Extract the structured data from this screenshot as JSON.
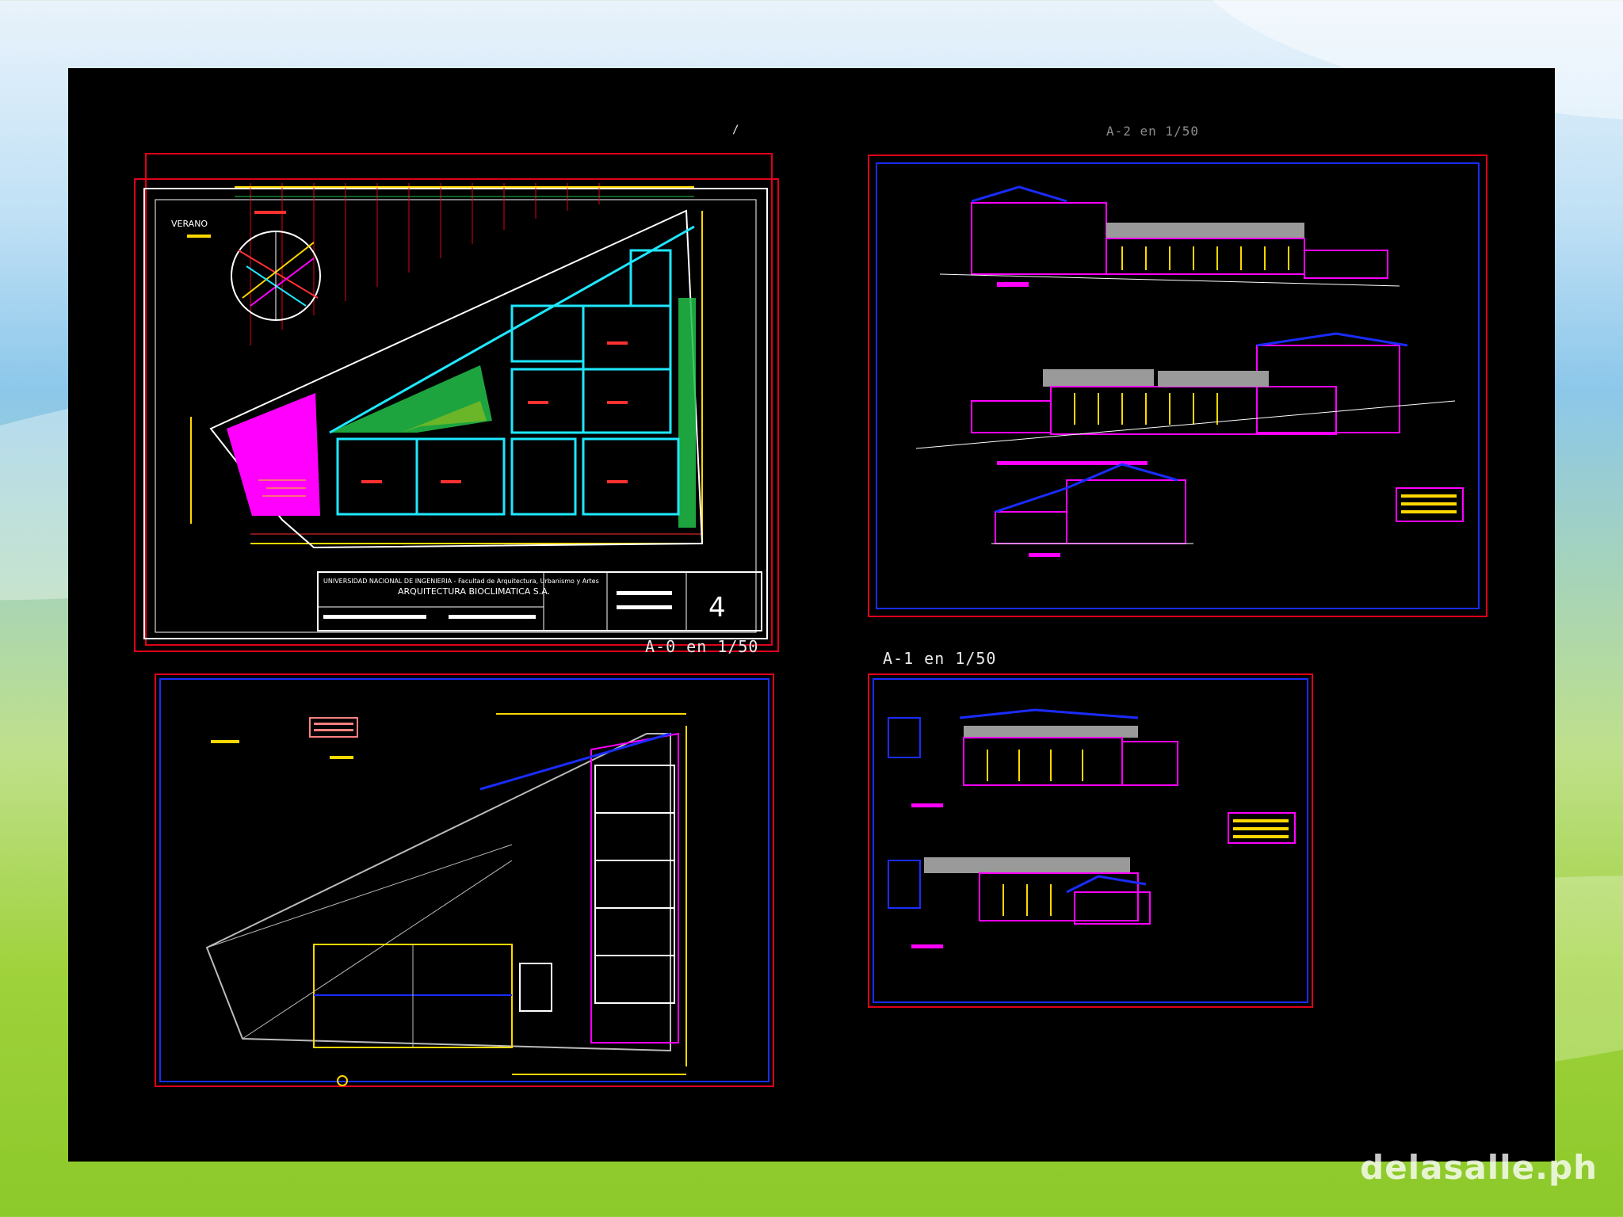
{
  "slide": {
    "watermark": "delasalle.ph"
  },
  "sheets": {
    "sheet_a0": {
      "scale_label": "A-0 en 1/50",
      "top_caption": "/"
    },
    "sheet_a1": {
      "scale_label": "A-1 en 1/50"
    },
    "sheet_top_right": {
      "top_caption": "A-2 en 1/50"
    }
  },
  "site_plan": {
    "season_label": "VERANO",
    "title_block": {
      "institution": "UNIVERSIDAD NACIONAL DE INGENIERIA - Facultad de Arquitectura, Urbanismo y Artes",
      "firm": "ARQUITECTURA BIOCLIMATICA S.A.",
      "sheet_number": "4"
    }
  },
  "colors": {
    "sheet_border": "#e0001b",
    "inner_border": "#1a2cff",
    "plan_walls": "#1ee8ff",
    "courtyard_green": "#22c14a",
    "plaza_magenta": "#ff00ff",
    "dimension_yellow": "#ffd800",
    "roof_grey": "#9a9a9a"
  }
}
